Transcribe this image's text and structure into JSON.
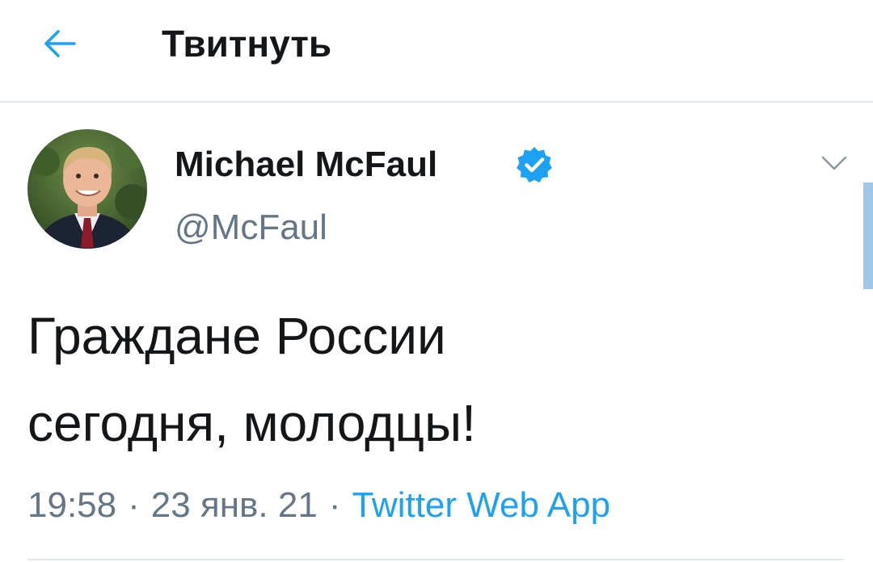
{
  "header": {
    "back_icon": "arrow-left-icon",
    "title": "Твитнуть"
  },
  "tweet": {
    "author": {
      "name": "Michael McFaul",
      "handle": "@McFaul",
      "verified": true,
      "verified_icon": "verified-badge-icon"
    },
    "menu_icon": "chevron-down-icon",
    "text_line1": "Граждане России",
    "text_line2": "сегодня, молодцы!",
    "time": "19:58",
    "date": "23 янв. 21",
    "source": "Twitter Web App",
    "separator": "·"
  },
  "colors": {
    "accent": "#1da1f2",
    "secondary_text": "#657786",
    "divider": "#e1e8ed"
  }
}
